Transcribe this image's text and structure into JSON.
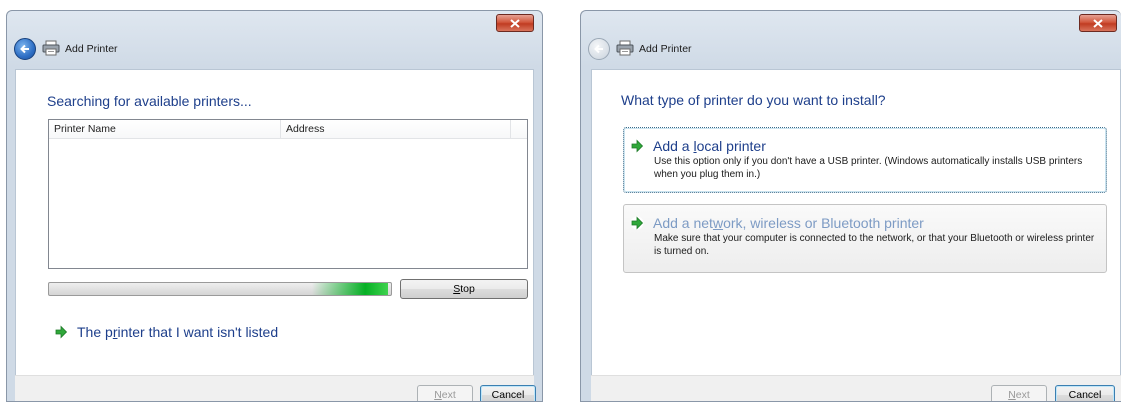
{
  "colors": {
    "link_blue": "#1e3f8b",
    "progress_green": "#06b025",
    "close_red": "#c03c22"
  },
  "window1": {
    "title": "Add Printer",
    "heading": "Searching for available printers...",
    "columns": [
      "Printer Name",
      "Address"
    ],
    "progress_fill_fraction": 0.99,
    "stop_button": {
      "pre": "",
      "key": "S",
      "post": "top"
    },
    "link": {
      "pre": "The p",
      "key": "r",
      "post": "inter that I want isn't listed"
    },
    "next_button": {
      "pre": "",
      "key": "N",
      "post": "ext",
      "enabled": false
    },
    "cancel_label": "Cancel",
    "icons": [
      "close-icon",
      "back-arrow-icon",
      "printer-icon",
      "green-arrow-icon"
    ]
  },
  "window2": {
    "title": "Add Printer",
    "heading": "What type of printer do you want to install?",
    "options": [
      {
        "title_pre": "Add a ",
        "title_key": "l",
        "title_post": "ocal printer",
        "description": "Use this option only if you don't have a USB printer. (Windows automatically installs USB printers when you plug them in.)",
        "state": "focused"
      },
      {
        "title_pre": "Add a net",
        "title_key": "w",
        "title_post": "ork, wireless or Bluetooth printer",
        "description": "Make sure that your computer is connected to the network, or that your Bluetooth or wireless printer is turned on.",
        "state": "hover"
      }
    ],
    "next_button": {
      "pre": "",
      "key": "N",
      "post": "ext",
      "enabled": false
    },
    "cancel_label": "Cancel"
  }
}
